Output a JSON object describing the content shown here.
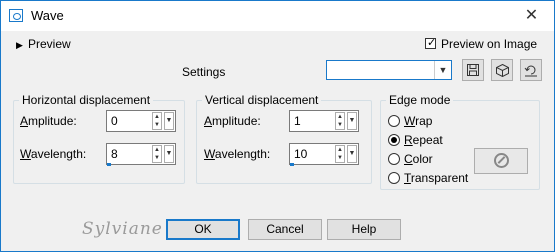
{
  "window": {
    "title": "Wave",
    "close_glyph": "✕"
  },
  "preview": {
    "label": "Preview",
    "arrow": "▶",
    "on_image_label": "Preview on Image",
    "on_image_checked": true
  },
  "settings": {
    "label": "Settings",
    "preset_value": ""
  },
  "toolbar": {
    "save_icon": "save-preset-icon",
    "randomize_icon": "randomize-icon",
    "reset_icon": "reset-icon"
  },
  "horizontal": {
    "title": "Horizontal displacement",
    "amplitude_label": "Amplitude:",
    "amplitude_value": "0",
    "wavelength_label": "Wavelength:",
    "wavelength_value": "8"
  },
  "vertical": {
    "title": "Vertical displacement",
    "amplitude_label": "Amplitude:",
    "amplitude_value": "1",
    "wavelength_label": "Wavelength:",
    "wavelength_value": "10"
  },
  "edge_mode": {
    "title": "Edge mode",
    "options": [
      "Wrap",
      "Repeat",
      "Color",
      "Transparent"
    ],
    "selected": "Repeat"
  },
  "buttons": {
    "ok": "OK",
    "cancel": "Cancel",
    "help": "Help"
  },
  "watermark": "Sylviane"
}
